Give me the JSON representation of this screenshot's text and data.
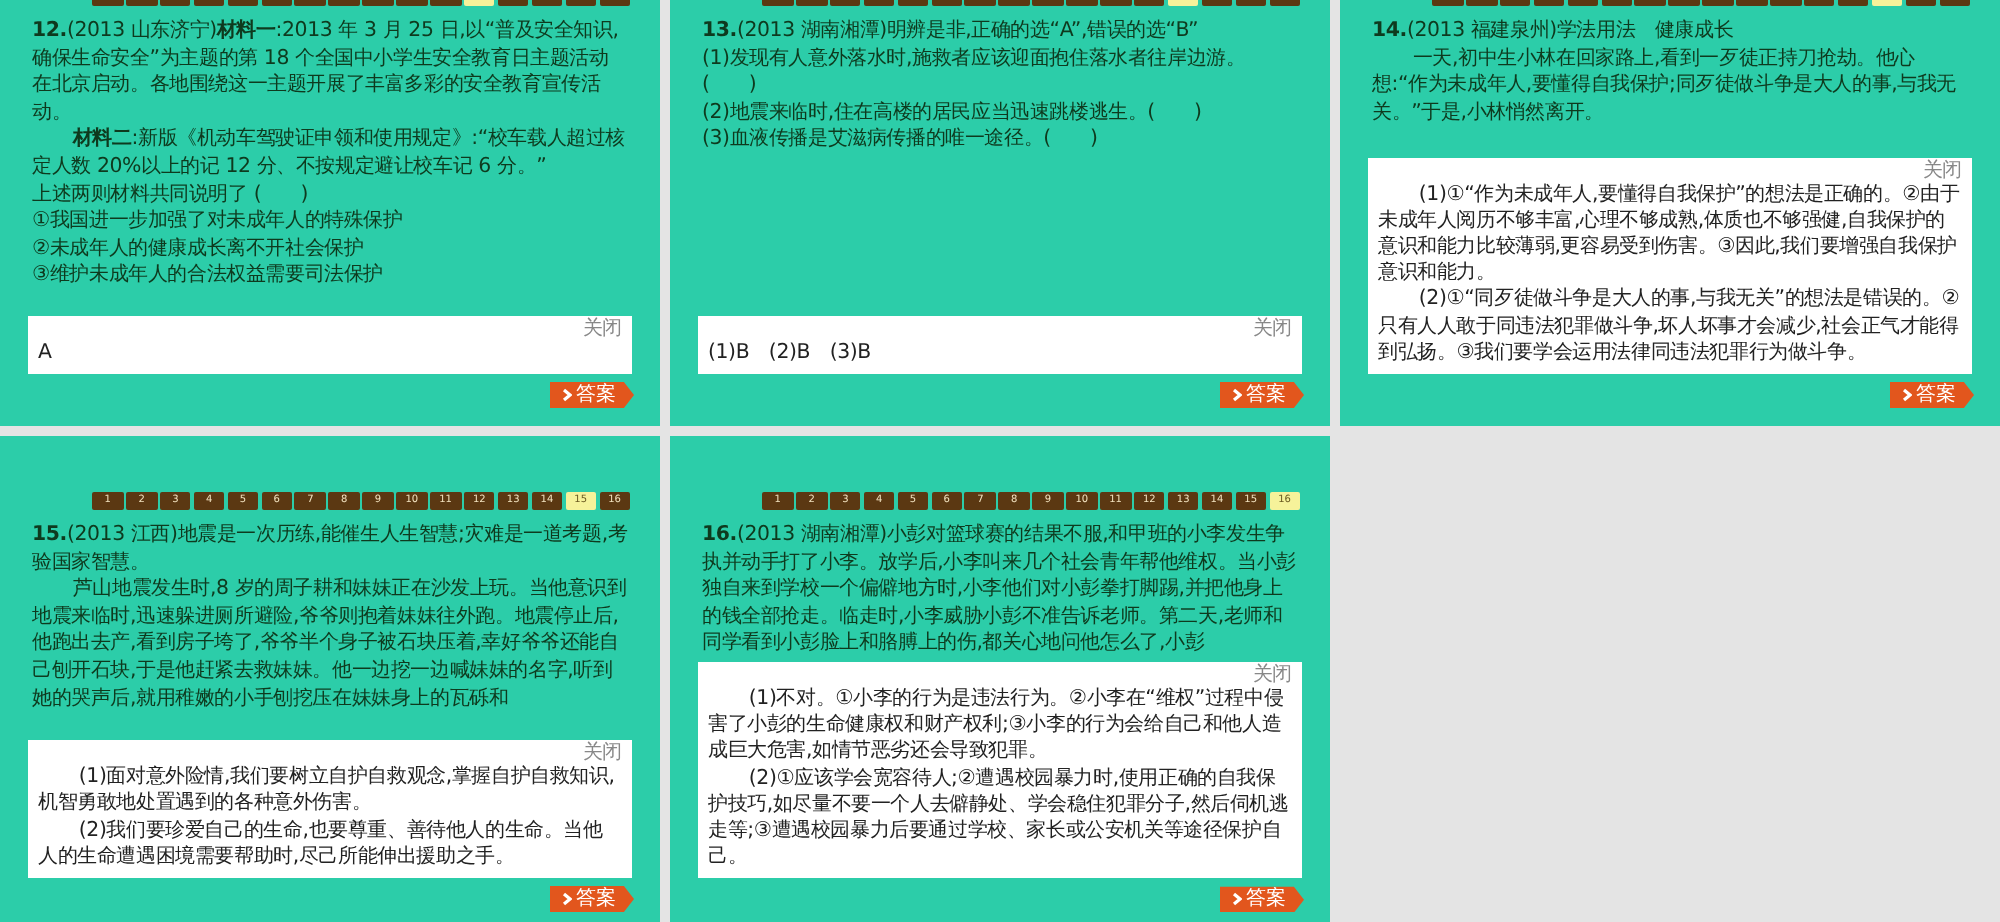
{
  "slides": [
    {
      "nav": [
        {
          "selected": false
        },
        {
          "selected": false
        },
        {
          "selected": false
        },
        {
          "selected": false
        },
        {
          "selected": false
        },
        {
          "selected": false
        },
        {
          "selected": false
        },
        {
          "selected": false
        },
        {
          "selected": false
        },
        {
          "selected": false
        },
        {
          "selected": false
        },
        {
          "selected": true
        },
        {
          "selected": false
        },
        {
          "selected": false
        },
        {
          "selected": false
        },
        {
          "selected": false
        }
      ],
      "question": [
        {
          "text": "**12.**(2013 山东济宁)**材料一**:2013 年 3 月 25 日,以“普及安全知识,确保生命安全”为主题的第 18 个全国中小学生安全教育日主题活动在北京启动。各地围绕这一主题开展了丰富多彩的安全教育宣传活动。",
          "indent": false
        },
        {
          "text": "**材料二**:新版《机动车驾驶证申领和使用规定》:“校车载人超过核定人数 20%以上的记 12 分、不按规定避让校车记 6 分。”",
          "indent": true
        },
        {
          "text": "上述两则材料共同说明了 (　　)",
          "indent": false
        },
        {
          "text": "①我国进一步加强了对未成年人的特殊保护",
          "indent": false
        },
        {
          "text": "②未成年人的健康成长离不开社会保护",
          "indent": false
        },
        {
          "text": "③维护未成年人的合法权益需要司法保护",
          "indent": false
        }
      ],
      "answer": {
        "close_label": "关闭",
        "paragraphs": [
          {
            "text": "A",
            "indent": false
          }
        ]
      },
      "answer_button": "答案"
    },
    {
      "nav": [
        {
          "selected": false
        },
        {
          "selected": false
        },
        {
          "selected": false
        },
        {
          "selected": false
        },
        {
          "selected": false
        },
        {
          "selected": false
        },
        {
          "selected": false
        },
        {
          "selected": false
        },
        {
          "selected": false
        },
        {
          "selected": false
        },
        {
          "selected": false
        },
        {
          "selected": false
        },
        {
          "selected": true
        },
        {
          "selected": false
        },
        {
          "selected": false
        },
        {
          "selected": false
        }
      ],
      "question": [
        {
          "text": "**13.**(2013 湖南湘潭)明辨是非,正确的选“A”,错误的选“B”",
          "indent": false
        },
        {
          "text": "(1)发现有人意外落水时,施救者应该迎面抱住落水者往岸边游。(　　)",
          "indent": false
        },
        {
          "text": "(2)地震来临时,住在高楼的居民应当迅速跳楼逃生。(　　)",
          "indent": false
        },
        {
          "text": "(3)血液传播是艾滋病传播的唯一途径。(　　)",
          "indent": false
        }
      ],
      "answer": {
        "close_label": "关闭",
        "paragraphs": [
          {
            "text": "(1)B　(2)B　(3)B",
            "indent": false
          }
        ]
      },
      "answer_button": "答案"
    },
    {
      "nav": [
        {
          "selected": false
        },
        {
          "selected": false
        },
        {
          "selected": false
        },
        {
          "selected": false
        },
        {
          "selected": false
        },
        {
          "selected": false
        },
        {
          "selected": false
        },
        {
          "selected": false
        },
        {
          "selected": false
        },
        {
          "selected": false
        },
        {
          "selected": false
        },
        {
          "selected": false
        },
        {
          "selected": false
        },
        {
          "selected": true
        },
        {
          "selected": false
        },
        {
          "selected": false
        }
      ],
      "question": [
        {
          "text": "**14.**(2013 福建泉州)学法用法　健康成长",
          "indent": false
        },
        {
          "text": "一天,初中生小林在回家路上,看到一歹徒正持刀抢劫。他心想:“作为未成年人,要懂得自我保护;同歹徒做斗争是大人的事,与我无关。”于是,小林悄然离开。",
          "indent": true
        }
      ],
      "answer": {
        "close_label": "关闭",
        "paragraphs": [
          {
            "text": "(1)①“作为未成年人,要懂得自我保护”的想法是正确的。②由于未成年人阅历不够丰富,心理不够成熟,体质也不够强健,自我保护的意识和能力比较薄弱,更容易受到伤害。③因此,我们要增强自我保护意识和能力。",
            "indent": true
          },
          {
            "text": "(2)①“同歹徒做斗争是大人的事,与我无关”的想法是错误的。②只有人人敢于同违法犯罪做斗争,坏人坏事才会减少,社会正气才能得到弘扬。③我们要学会运用法律同违法犯罪行为做斗争。",
            "indent": true
          }
        ]
      },
      "answer_button": "答案"
    },
    {
      "nav": [
        {
          "label": "1",
          "selected": false
        },
        {
          "label": "2",
          "selected": false
        },
        {
          "label": "3",
          "selected": false
        },
        {
          "label": "4",
          "selected": false
        },
        {
          "label": "5",
          "selected": false
        },
        {
          "label": "6",
          "selected": false
        },
        {
          "label": "7",
          "selected": false
        },
        {
          "label": "8",
          "selected": false
        },
        {
          "label": "9",
          "selected": false
        },
        {
          "label": "10",
          "selected": false
        },
        {
          "label": "11",
          "selected": false
        },
        {
          "label": "12",
          "selected": false
        },
        {
          "label": "13",
          "selected": false
        },
        {
          "label": "14",
          "selected": false
        },
        {
          "label": "15",
          "selected": true
        },
        {
          "label": "16",
          "selected": false
        }
      ],
      "question": [
        {
          "text": "**15.**(2013 江西)地震是一次历练,能催生人生智慧;灾难是一道考题,考验国家智慧。",
          "indent": false
        },
        {
          "text": "芦山地震发生时,8 岁的周子耕和妹妹正在沙发上玩。当他意识到地震来临时,迅速躲进厕所避险,爷爷则抱着妹妹往外跑。地震停止后,他跑出去产,看到房子垮了,爷爷半个身子被石块压着,幸好爷爷还能自己刨开石块,于是他赶紧去救妹妹。他一边挖一边喊妹妹的名字,听到她的哭声后,就用稚嫩的小手刨挖压在妹妹身上的瓦砾和",
          "indent": true
        }
      ],
      "answer": {
        "close_label": "关闭",
        "paragraphs": [
          {
            "text": "(1)面对意外险情,我们要树立自护自救观念,掌握自护自救知识,机智勇敢地处置遇到的各种意外伤害。",
            "indent": true
          },
          {
            "text": "(2)我们要珍爱自己的生命,也要尊重、善待他人的生命。当他人的生命遭遇困境需要帮助时,尽己所能伸出援助之手。",
            "indent": true
          }
        ]
      },
      "answer_button": "答案"
    },
    {
      "nav": [
        {
          "label": "1",
          "selected": false
        },
        {
          "label": "2",
          "selected": false
        },
        {
          "label": "3",
          "selected": false
        },
        {
          "label": "4",
          "selected": false
        },
        {
          "label": "5",
          "selected": false
        },
        {
          "label": "6",
          "selected": false
        },
        {
          "label": "7",
          "selected": false
        },
        {
          "label": "8",
          "selected": false
        },
        {
          "label": "9",
          "selected": false
        },
        {
          "label": "10",
          "selected": false
        },
        {
          "label": "11",
          "selected": false
        },
        {
          "label": "12",
          "selected": false
        },
        {
          "label": "13",
          "selected": false
        },
        {
          "label": "14",
          "selected": false
        },
        {
          "label": "15",
          "selected": false
        },
        {
          "label": "16",
          "selected": true
        }
      ],
      "question": [
        {
          "text": "**16.**(2013 湖南湘潭)小彭对篮球赛的结果不服,和甲班的小李发生争执并动手打了小李。放学后,小李叫来几个社会青年帮他维权。当小彭独自来到学校一个偏僻地方时,小李他们对小彭拳打脚踢,并把他身上的钱全部抢走。临走时,小李威胁小彭不准告诉老师。第二天,老师和同学看到小彭脸上和胳膊上的伤,都关心地问他怎么了,小彭",
          "indent": false
        }
      ],
      "answer": {
        "close_label": "关闭",
        "paragraphs": [
          {
            "text": "(1)不对。①小李的行为是违法行为。②小李在“维权”过程中侵害了小彭的生命健康权和财产权利;③小李的行为会给自己和他人造成巨大危害,如情节恶劣还会导致犯罪。",
            "indent": true
          },
          {
            "text": "(2)①应该学会宽容待人;②遭遇校园暴力时,使用正确的自我保护技巧,如尽量不要一个人去僻静处、学会稳住犯罪分子,然后伺机逃走等;③遭遇校园暴力后要通过学校、家长或公安机关等途径保护自己。",
            "indent": true
          }
        ]
      },
      "answer_button": "答案"
    }
  ]
}
